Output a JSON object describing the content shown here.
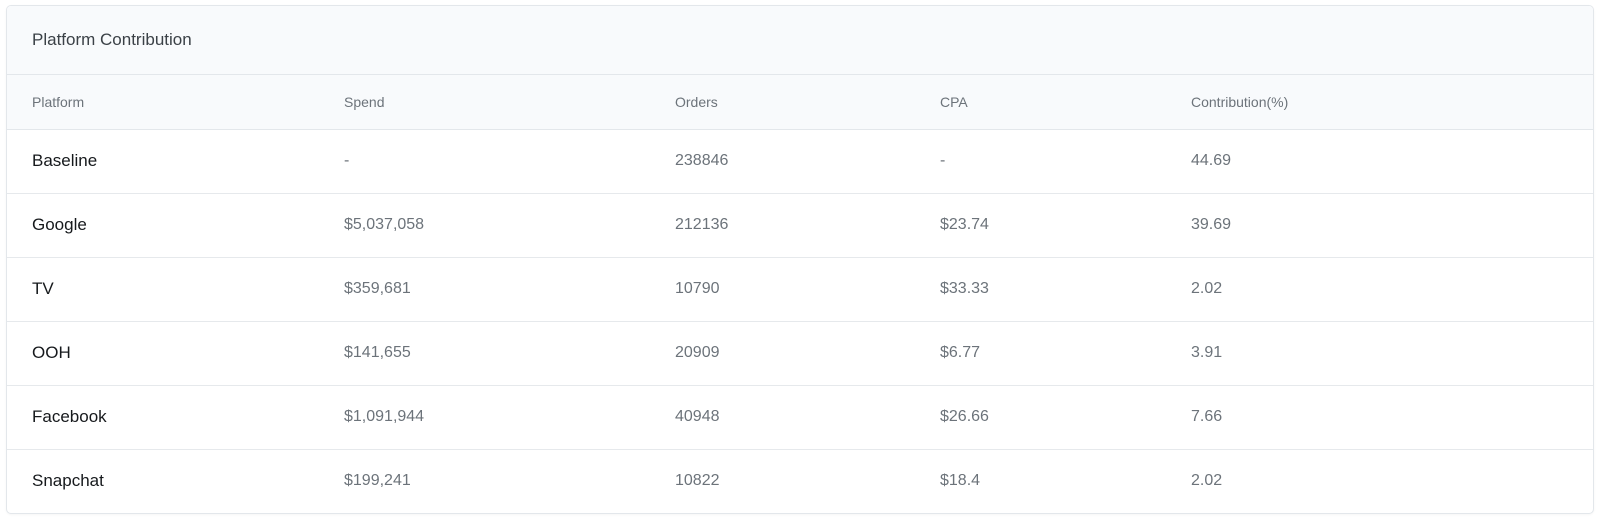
{
  "card": {
    "title": "Platform Contribution"
  },
  "table": {
    "columns": [
      "Platform",
      "Spend",
      "Orders",
      "CPA",
      "Contribution(%)"
    ],
    "rows": [
      {
        "platform": "Baseline",
        "spend": "-",
        "orders": "238846",
        "cpa": "-",
        "contribution": "44.69"
      },
      {
        "platform": "Google",
        "spend": "$5,037,058",
        "orders": "212136",
        "cpa": "$23.74",
        "contribution": "39.69"
      },
      {
        "platform": "TV",
        "spend": "$359,681",
        "orders": "10790",
        "cpa": "$33.33",
        "contribution": "2.02"
      },
      {
        "platform": "OOH",
        "spend": "$141,655",
        "orders": "20909",
        "cpa": "$6.77",
        "contribution": "3.91"
      },
      {
        "platform": "Facebook",
        "spend": "$1,091,944",
        "orders": "40948",
        "cpa": "$26.66",
        "contribution": "7.66"
      },
      {
        "platform": "Snapchat",
        "spend": "$199,241",
        "orders": "10822",
        "cpa": "$18.4",
        "contribution": "2.02"
      }
    ]
  }
}
